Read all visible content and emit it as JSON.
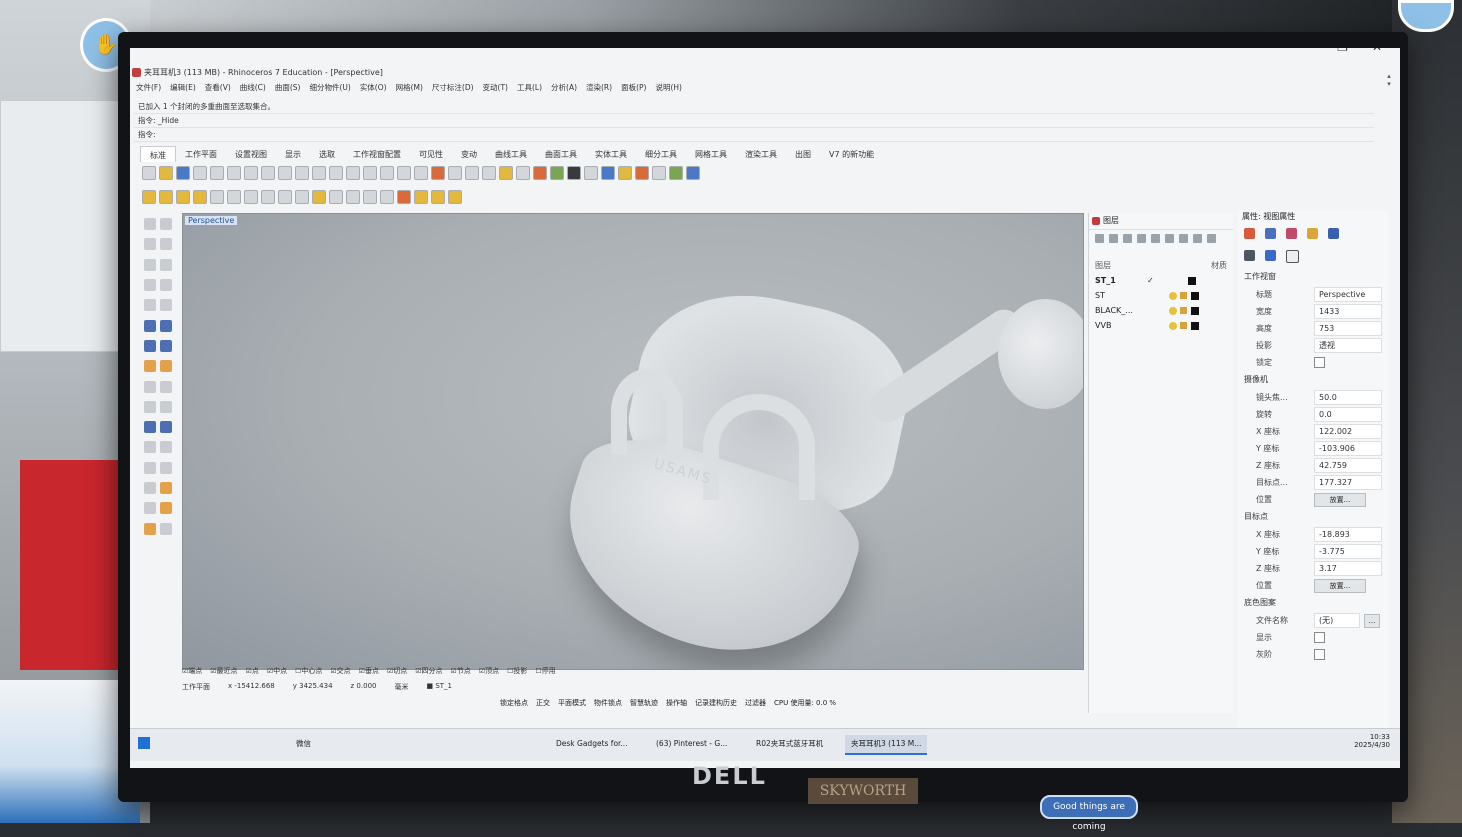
{
  "window": {
    "title": "夹耳耳机3 (113 MB) - Rhinoceros 7 Education - [Perspective]",
    "controls": [
      "—",
      "❐",
      "✕"
    ]
  },
  "menu": [
    "文件(F)",
    "编辑(E)",
    "查看(V)",
    "曲线(C)",
    "曲面(S)",
    "细分物件(U)",
    "实体(O)",
    "网格(M)",
    "尺寸标注(D)",
    "变动(T)",
    "工具(L)",
    "分析(A)",
    "渲染(R)",
    "面板(P)",
    "说明(H)"
  ],
  "command": {
    "history": "已加入 1 个封闭的多重曲面至选取集合。",
    "line1": "指令: _Hide",
    "prompt": "指令:"
  },
  "tabs": [
    "标准",
    "工作平面",
    "设置视图",
    "显示",
    "选取",
    "工作视窗配置",
    "可见性",
    "变动",
    "曲线工具",
    "曲面工具",
    "实体工具",
    "细分工具",
    "网格工具",
    "渲染工具",
    "出图",
    "V7 的新功能"
  ],
  "viewport": {
    "label": "Perspective",
    "brand": "USAMS"
  },
  "layers": {
    "title": "图层",
    "col_layer": "图层",
    "col_material": "材质",
    "rows": [
      {
        "name": "ST_1",
        "current": "✓"
      },
      {
        "name": "ST",
        "current": ""
      },
      {
        "name": "BLACK_...",
        "current": ""
      },
      {
        "name": "VVB",
        "current": ""
      }
    ]
  },
  "properties": {
    "title": "属性: 视图属性",
    "viewport_section": "工作视窗",
    "rows": [
      {
        "label": "标题",
        "value": "Perspective"
      },
      {
        "label": "宽度",
        "value": "1433"
      },
      {
        "label": "高度",
        "value": "753"
      },
      {
        "label": "投影",
        "value": "透视"
      }
    ],
    "lock_label": "锁定",
    "camera_section": "摄像机",
    "camera": [
      {
        "label": "镜头焦...",
        "value": "50.0"
      },
      {
        "label": "旋转",
        "value": "0.0"
      },
      {
        "label": "X 座标",
        "value": "122.002"
      },
      {
        "label": "Y 座标",
        "value": "-103.906"
      },
      {
        "label": "Z 座标",
        "value": "42.759"
      },
      {
        "label": "目标点...",
        "value": "177.327"
      }
    ],
    "position_label": "位置",
    "place_button": "放置...",
    "target_section": "目标点",
    "target": [
      {
        "label": "X 座标",
        "value": "-18.893"
      },
      {
        "label": "Y 座标",
        "value": "-3.775"
      },
      {
        "label": "Z 座标",
        "value": "3.17"
      }
    ],
    "target_position_label": "位置",
    "target_place_button": "放置...",
    "wallpaper_section": "底色图案",
    "filename_label": "文件名称",
    "filename_value": "(无)",
    "filename_button": "...",
    "show_label": "显示",
    "gray_label": "灰阶"
  },
  "osnap": [
    "☑端点",
    "☑最近点",
    "☑点",
    "☑中点",
    "☐中心点",
    "☑交点",
    "☑垂点",
    "☑切点",
    "☑四分点",
    "☑节点",
    "☑顶点",
    "☐投影",
    "☐停用"
  ],
  "coords": {
    "plane": "工作平面",
    "x": "x -15412.668",
    "y": "y 3425.434",
    "z": "z 0.000",
    "unit": "毫米",
    "layer": "■ ST_1"
  },
  "statusbar": [
    "锁定格点",
    "正交",
    "平面模式",
    "物件锁点",
    "智慧轨迹",
    "操作轴",
    "记录建构历史",
    "过滤器",
    "CPU 使用量: 0.0 %"
  ],
  "taskbar": {
    "tasks": [
      {
        "label": "微信"
      },
      {
        "label": "Desk Gadgets for..."
      },
      {
        "label": "(63) Pinterest - G..."
      },
      {
        "label": "R02夹耳式蓝牙耳机"
      },
      {
        "label": "夹耳耳机3 (113 M..."
      }
    ],
    "time": "10:33",
    "date": "2025/4/30"
  },
  "monitor": {
    "brand": "DELL",
    "stand_brand": "SKYWORTH",
    "badge": "Good things are coming"
  }
}
